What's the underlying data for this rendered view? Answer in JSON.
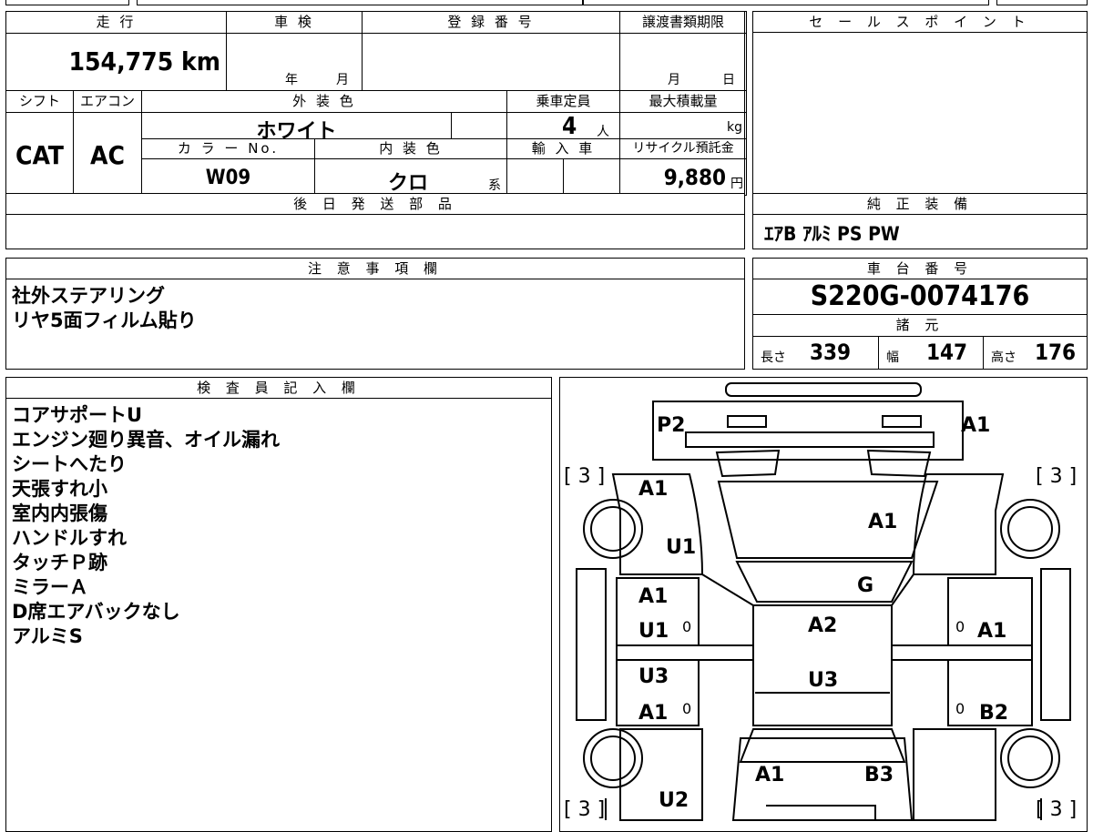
{
  "row1": {
    "mileage_label": "走 行",
    "mileage_value": "154,775 km",
    "inspection_label": "車 検",
    "inspection_year": "年",
    "inspection_month": "月",
    "reg_label": "登 録 番 号",
    "transfer_label": "譲渡書類期限",
    "transfer_month": "月",
    "transfer_day": "日"
  },
  "row2": {
    "shift_label": "シフト",
    "ac_label": "エアコン",
    "ext_color_label": "外 装 色",
    "capacity_label": "乗車定員",
    "maxload_label": "最大積載量",
    "shift_value": "CAT",
    "ac_value": "AC",
    "ext_color_value": "ホワイト",
    "capacity_value": "4",
    "capacity_unit": "人",
    "maxload_unit": "kg",
    "color_no_label": "カ ラ ー No.",
    "int_color_label": "内 装 色",
    "import_label": "輸 入 車",
    "recycle_label": "リサイクル預託金",
    "color_no_value": "W09",
    "int_color_value": "クロ",
    "int_color_suffix": "系",
    "recycle_value": "9,880",
    "recycle_unit": "円"
  },
  "later_parts_label": "後 日 発 送 部 品",
  "sales_point_label": "セ ー ル ス ポ イ ン ト",
  "equipment": {
    "label": "純 正 装 備",
    "value": "ｴｱB ｱﾙﾐ PS PW"
  },
  "notes": {
    "label": "注 意 事 項 欄",
    "lines": [
      "社外ステアリング",
      "リヤ5面フィルム貼り"
    ]
  },
  "chassis": {
    "label": "車 台 番 号",
    "value": "S220G-0074176"
  },
  "specs": {
    "label": "諸 元",
    "length_label": "長さ",
    "length_value": "339",
    "width_label": "幅",
    "width_value": "147",
    "height_label": "高さ",
    "height_value": "176"
  },
  "inspector": {
    "label": "検 査 員 記 入 欄",
    "lines": [
      "コアサポートU",
      "エンジン廻り異音、オイル漏れ",
      "シートへたり",
      "天張すれ小",
      "室内内張傷",
      "ハンドルすれ",
      "タッチＰ跡",
      "ミラーＡ",
      "D席エアバックなし",
      "アルミS"
    ]
  },
  "diagram": {
    "marks": {
      "p2": "P2",
      "a1_top_right": "A1",
      "bracket_tl": "[ 3 ]",
      "bracket_tr": "[ 3 ]",
      "bracket_bl": "[ 3 ]",
      "bracket_br": "[ 3 ]",
      "a1_fl_fender": "A1",
      "u1_fl": "U1",
      "a1_hood": "A1",
      "g_windshield": "G",
      "a1_fl_door": "A1",
      "u1_fl_door": "U1",
      "a2_roof": "A2",
      "a1_fr_door": "A1",
      "u3_rl_door": "U3",
      "a1_rl_door": "A1",
      "u3_roof": "U3",
      "b2_rr_door": "B2",
      "a1_rear": "A1",
      "b3_rear": "B3",
      "u2_rl": "U2",
      "zero1": "0",
      "zero2": "0",
      "zero3": "0",
      "zero4": "0"
    }
  }
}
